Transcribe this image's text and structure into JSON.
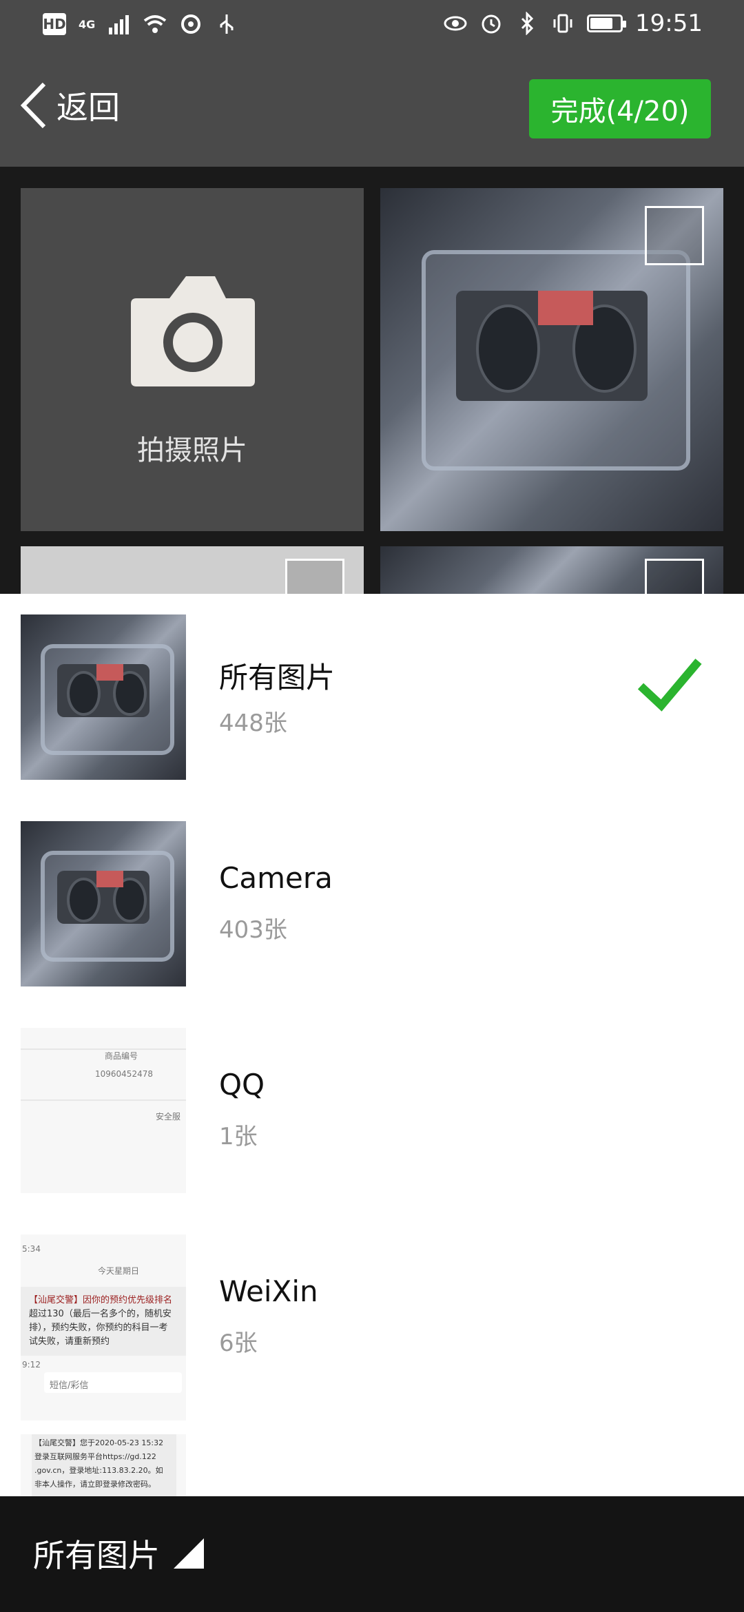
{
  "status_bar": {
    "left": [
      "HD",
      "4G"
    ],
    "time": "19:51"
  },
  "header": {
    "back_label": "返回",
    "done_label": "完成(4/20)"
  },
  "grid": {
    "camera_label": "拍摄照片"
  },
  "albums": [
    {
      "name": "所有图片",
      "count": "448张",
      "selected": true
    },
    {
      "name": "Camera",
      "count": "403张",
      "selected": false
    },
    {
      "name": "QQ",
      "count": "1张",
      "selected": false
    },
    {
      "name": "WeiXin",
      "count": "6张",
      "selected": false
    }
  ],
  "doc_thumbs": {
    "qq": {
      "line1": "商品编号",
      "line2": "10960452478",
      "line3": "安全服"
    },
    "weixin": {
      "time": "5:34",
      "date": "今天星期日",
      "line1": "【汕尾交警】因你的预约优先级排名",
      "line2": "超过130（最后一名多个的，随机安",
      "line3": "排），预约失败，你预约的科目一考",
      "line4": "试失败，请重新预约",
      "time2": "9:12",
      "sms": "短信/彩信",
      "line5": "【汕尾交警】您于2020-05-23 15:32",
      "line6": "登录互联网服务平台https://gd.122",
      "line7": ".gov.cn，登录地址:113.83.2.20。如",
      "line8": "非本人操作，请立即登录修改密码。"
    }
  },
  "footer": {
    "album_label": "所有图片"
  },
  "colors": {
    "accent_green": "#2bb42f",
    "header_bg": "#4a4a4a"
  }
}
